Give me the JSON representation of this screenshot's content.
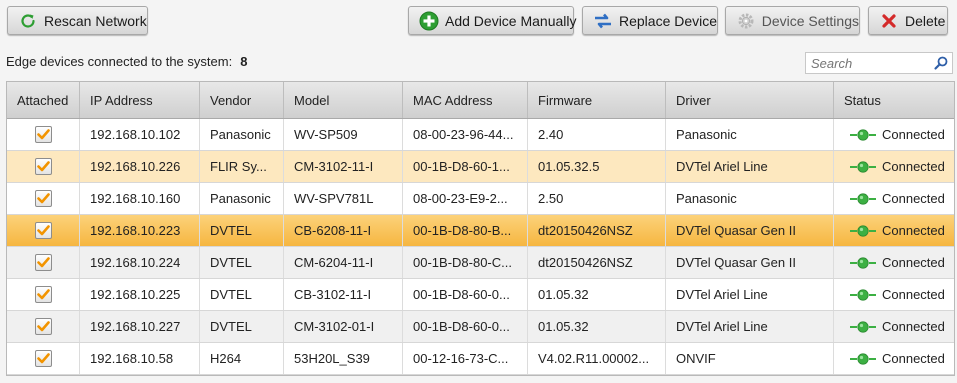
{
  "toolbar": {
    "rescan_label": "Rescan Network",
    "add_label": "Add Device Manually",
    "replace_label": "Replace Device",
    "settings_label": "Device Settings",
    "delete_label": "Delete"
  },
  "summary": {
    "label": "Edge devices connected to the system:",
    "count": "8"
  },
  "search": {
    "placeholder": "Search"
  },
  "colors": {
    "selected_row": "#f6b640",
    "hover_row": "#fde8bf",
    "status_green": "#3cb043",
    "add_green": "#2e9e33",
    "delete_red": "#d42a2a",
    "replace_blue": "#2f6fc4",
    "checkbox_orange": "#f29400"
  },
  "table": {
    "columns": [
      "Attached",
      "IP Address",
      "Vendor",
      "Model",
      "MAC Address",
      "Firmware",
      "Driver",
      "Status"
    ],
    "rows": [
      {
        "attached": true,
        "ip": "192.168.10.102",
        "vendor": "Panasonic",
        "model": "WV-SP509",
        "mac": "08-00-23-96-44...",
        "firmware": "2.40",
        "driver": "Panasonic",
        "status": "Connected",
        "state": "normal"
      },
      {
        "attached": true,
        "ip": "192.168.10.226",
        "vendor": "FLIR Sy...",
        "model": "CM-3102-11-I",
        "mac": "00-1B-D8-60-1...",
        "firmware": "01.05.32.5",
        "driver": "DVTel Ariel Line",
        "status": "Connected",
        "state": "hover"
      },
      {
        "attached": true,
        "ip": "192.168.10.160",
        "vendor": "Panasonic",
        "model": "WV-SPV781L",
        "mac": "08-00-23-E9-2...",
        "firmware": "2.50",
        "driver": "Panasonic",
        "status": "Connected",
        "state": "normal"
      },
      {
        "attached": true,
        "ip": "192.168.10.223",
        "vendor": "DVTEL",
        "model": "CB-6208-11-I",
        "mac": "00-1B-D8-80-B...",
        "firmware": "dt20150426NSZ",
        "driver": "DVTel Quasar Gen II",
        "status": "Connected",
        "state": "selected"
      },
      {
        "attached": true,
        "ip": "192.168.10.224",
        "vendor": "DVTEL",
        "model": "CM-6204-11-I",
        "mac": "00-1B-D8-80-C...",
        "firmware": "dt20150426NSZ",
        "driver": "DVTel Quasar Gen II",
        "status": "Connected",
        "state": "alt"
      },
      {
        "attached": true,
        "ip": "192.168.10.225",
        "vendor": "DVTEL",
        "model": "CB-3102-11-I",
        "mac": "00-1B-D8-60-0...",
        "firmware": "01.05.32",
        "driver": "DVTel Ariel Line",
        "status": "Connected",
        "state": "normal"
      },
      {
        "attached": true,
        "ip": "192.168.10.227",
        "vendor": "DVTEL",
        "model": "CM-3102-01-I",
        "mac": "00-1B-D8-60-0...",
        "firmware": "01.05.32",
        "driver": "DVTel Ariel Line",
        "status": "Connected",
        "state": "alt"
      },
      {
        "attached": true,
        "ip": "192.168.10.58",
        "vendor": "H264",
        "model": "53H20L_S39",
        "mac": "00-12-16-73-C...",
        "firmware": "V4.02.R11.00002...",
        "driver": "ONVIF",
        "status": "Connected",
        "state": "normal"
      }
    ]
  }
}
